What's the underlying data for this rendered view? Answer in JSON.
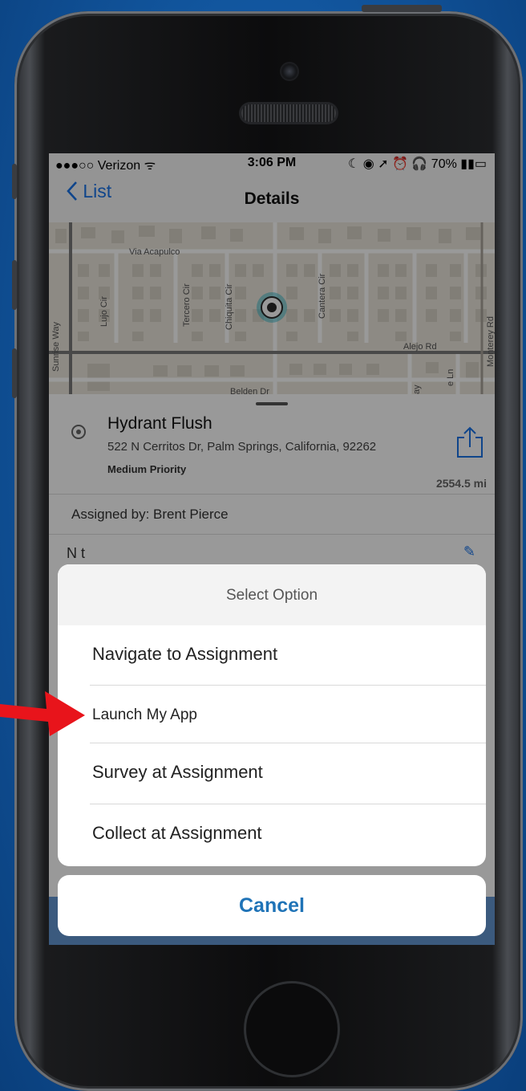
{
  "status_bar": {
    "carrier": "●●●○○ Verizon ᯤ",
    "time": "3:06 PM",
    "right": "☾ ◉ ➚ ⏰ 🎧 70% ▮▮▭"
  },
  "nav": {
    "back_icon": "chevron-left",
    "back_label": "List",
    "title": "Details"
  },
  "map": {
    "street_labels": [
      "Via Acapulco",
      "Lujo Cir",
      "Tercero Cir",
      "Chiquita Cir",
      "Cantera Cir",
      "Sunrise Way",
      "Alejo Rd",
      "Monterey Rd",
      "Belden Dr",
      "e Ln",
      "ay"
    ]
  },
  "assignment": {
    "title": "Hydrant Flush",
    "address": "522 N Cerritos Dr, Palm Springs, California, 92262",
    "priority": "Medium Priority",
    "distance": "2554.5 mi",
    "assigned_by": "Assigned by: Brent Pierce",
    "notes_label": "N t",
    "edit_icon": "pencil-icon"
  },
  "action_sheet": {
    "header": "Select Option",
    "options": [
      {
        "label": "Navigate to Assignment"
      },
      {
        "label": "Launch My App"
      },
      {
        "label": "Survey at Assignment"
      },
      {
        "label": "Collect at Assignment"
      }
    ],
    "cancel": "Cancel"
  },
  "colors": {
    "accent": "#1f73b7",
    "arrow": "#e8141b",
    "background": "#1257a0"
  }
}
